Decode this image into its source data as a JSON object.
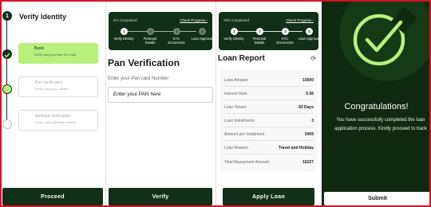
{
  "identity": {
    "step_number": "1",
    "title": "Verify Identity",
    "steps": [
      {
        "title": "Basic",
        "desc": "Verify using number & E-mail"
      },
      {
        "title": "Pan Verification",
        "desc": "Verify using pan details"
      },
      {
        "title": "Aadhaar verification",
        "desc": "Verify using aadhaar number"
      }
    ],
    "proceed_label": "Proceed"
  },
  "pan": {
    "progress_text": "5% Completed",
    "check_progress": "Check Progress ›",
    "stepper": [
      {
        "num": "1",
        "label": "Verify Identity"
      },
      {
        "num": "2",
        "label": "Personal Details"
      },
      {
        "num": "3",
        "label": "KYC Documents"
      },
      {
        "num": "4",
        "label": "Loan Approval"
      }
    ],
    "heading": "Pan Verification",
    "field_label": "Enter your Pan card Number",
    "field_placeholder": "Enter your PAN here",
    "verify_label": "Verify"
  },
  "report": {
    "progress_text": "75% Completed",
    "check_progress": "Check Progress ›",
    "stepper": [
      {
        "num": "1",
        "label": "Verify Identity"
      },
      {
        "num": "2",
        "label": "Personal Details"
      },
      {
        "num": "3",
        "label": "KYC Documents"
      },
      {
        "num": "4",
        "label": "Loan Approval"
      }
    ],
    "heading": "Loan Report",
    "rows": [
      {
        "key": "Loan Amount",
        "value": "15000"
      },
      {
        "key": "Interest Rate",
        "value": "0.36"
      },
      {
        "key": "Loan Tenure",
        "value": "83 Days"
      },
      {
        "key": "Loan Instalments",
        "value": "3"
      },
      {
        "key": "Amount per Instalment",
        "value": "5409"
      },
      {
        "key": "Loan Reason",
        "value": "Travel and Holiday"
      },
      {
        "key": "Total Repayment Amount",
        "value": "16227"
      }
    ],
    "apply_label": "Apply Loan"
  },
  "success": {
    "title": "Congratulations!",
    "message": "You have successfully completed the loan application process. Kindly proceed to track",
    "submit_label": "Submit"
  },
  "colors": {
    "primary_dark": "#113017",
    "accent_green": "#b9f07c",
    "success_bg": "#0f2a0f"
  }
}
